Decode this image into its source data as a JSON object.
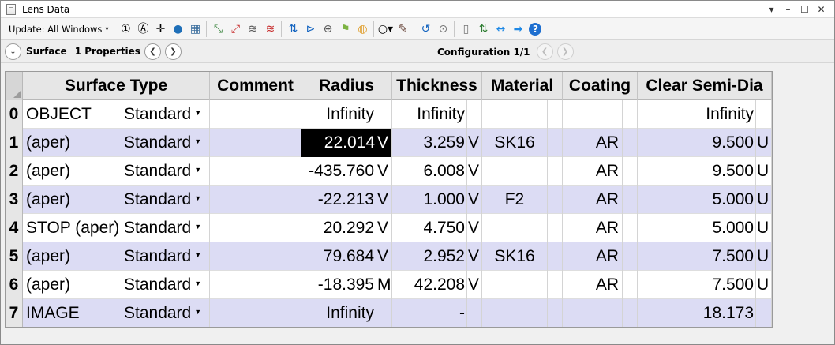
{
  "window": {
    "title": "Lens Data",
    "controls": {
      "dropdown": "▾",
      "minimize": "–",
      "maximize": "☐",
      "close": "✕"
    }
  },
  "toolbar": {
    "update_label": "Update: All Windows",
    "update_caret": "▾",
    "icons": [
      {
        "name": "ray-trace-1-icon",
        "glyph": "①",
        "color": "#000000"
      },
      {
        "name": "ray-trace-all-icon",
        "glyph": "Ⓐ",
        "color": "#000000"
      },
      {
        "name": "add-crosshair-icon",
        "glyph": "✛",
        "color": "#000000"
      },
      {
        "name": "globe-icon",
        "glyph": "●",
        "color": "#1e6fb8"
      },
      {
        "name": "catalog-icon",
        "glyph": "▦",
        "color": "#3b6e9e"
      },
      {
        "name": "sep"
      },
      {
        "name": "insert-surface-icon",
        "glyph": "⤡",
        "color": "#2e7d32"
      },
      {
        "name": "delete-surface-icon",
        "glyph": "⤢",
        "color": "#c62828"
      },
      {
        "name": "layers-icon",
        "glyph": "≋",
        "color": "#555555"
      },
      {
        "name": "remove-layers-icon",
        "glyph": "≋",
        "color": "#c62828"
      },
      {
        "name": "sep"
      },
      {
        "name": "tilt-decenter-icon",
        "glyph": "⇅",
        "color": "#1565c0"
      },
      {
        "name": "fold-mirror-icon",
        "glyph": "⊳",
        "color": "#1565c0"
      },
      {
        "name": "element-icon",
        "glyph": "⊕",
        "color": "#555555"
      },
      {
        "name": "flag-icon",
        "glyph": "⚑",
        "color": "#7cb342"
      },
      {
        "name": "palette-icon",
        "glyph": "◍",
        "color": "#e0a030"
      },
      {
        "name": "sep"
      },
      {
        "name": "circle-options-icon",
        "glyph": "○▾",
        "color": "#000000"
      },
      {
        "name": "pen-icon",
        "glyph": "✎",
        "color": "#6d4c41"
      },
      {
        "name": "sep"
      },
      {
        "name": "undo-arrow-icon",
        "glyph": "↺",
        "color": "#1565c0"
      },
      {
        "name": "toggle-icon",
        "glyph": "⊙",
        "color": "#777777"
      },
      {
        "name": "sep"
      },
      {
        "name": "page-icon",
        "glyph": "▯",
        "color": "#777777"
      },
      {
        "name": "swap-icon",
        "glyph": "⇅",
        "color": "#2e7d32"
      },
      {
        "name": "arrows-inward-icon",
        "glyph": "↔",
        "color": "#1e88e5"
      },
      {
        "name": "arrow-right-icon",
        "glyph": "➡",
        "color": "#1e88e5"
      },
      {
        "name": "help-icon",
        "glyph": "?",
        "color": "#ffffff"
      }
    ]
  },
  "navbar": {
    "surface_label": "Surface",
    "properties_label": "1 Properties",
    "configuration_label": "Configuration 1/1"
  },
  "table": {
    "headers": {
      "surface_type": "Surface Type",
      "comment": "Comment",
      "radius": "Radius",
      "thickness": "Thickness",
      "material": "Material",
      "coating": "Coating",
      "clear_semi_dia": "Clear Semi-Dia"
    },
    "rows": [
      {
        "num": "0",
        "name": "OBJECT",
        "type": "Standard",
        "comment": "",
        "radius": "Infinity",
        "radius_solve": "",
        "thickness": "Infinity",
        "thickness_solve": "",
        "material": "",
        "coating": "",
        "semi_dia": "Infinity",
        "semi_dia_solve": ""
      },
      {
        "num": "1",
        "name": "(aper)",
        "type": "Standard",
        "comment": "",
        "radius": "22.014",
        "radius_solve": "V",
        "thickness": "3.259",
        "thickness_solve": "V",
        "material": "SK16",
        "coating": "AR",
        "semi_dia": "9.500",
        "semi_dia_solve": "U"
      },
      {
        "num": "2",
        "name": "(aper)",
        "type": "Standard",
        "comment": "",
        "radius": "-435.760",
        "radius_solve": "V",
        "thickness": "6.008",
        "thickness_solve": "V",
        "material": "",
        "coating": "AR",
        "semi_dia": "9.500",
        "semi_dia_solve": "U"
      },
      {
        "num": "3",
        "name": "(aper)",
        "type": "Standard",
        "comment": "",
        "radius": "-22.213",
        "radius_solve": "V",
        "thickness": "1.000",
        "thickness_solve": "V",
        "material": "F2",
        "coating": "AR",
        "semi_dia": "5.000",
        "semi_dia_solve": "U"
      },
      {
        "num": "4",
        "name": "STOP (aper)",
        "type": "Standard",
        "comment": "",
        "radius": "20.292",
        "radius_solve": "V",
        "thickness": "4.750",
        "thickness_solve": "V",
        "material": "",
        "coating": "AR",
        "semi_dia": "5.000",
        "semi_dia_solve": "U"
      },
      {
        "num": "5",
        "name": "(aper)",
        "type": "Standard",
        "comment": "",
        "radius": "79.684",
        "radius_solve": "V",
        "thickness": "2.952",
        "thickness_solve": "V",
        "material": "SK16",
        "coating": "AR",
        "semi_dia": "7.500",
        "semi_dia_solve": "U"
      },
      {
        "num": "6",
        "name": "(aper)",
        "type": "Standard",
        "comment": "",
        "radius": "-18.395",
        "radius_solve": "M",
        "thickness": "42.208",
        "thickness_solve": "V",
        "material": "",
        "coating": "AR",
        "semi_dia": "7.500",
        "semi_dia_solve": "U"
      },
      {
        "num": "7",
        "name": "IMAGE",
        "type": "Standard",
        "comment": "",
        "radius": "Infinity",
        "radius_solve": "",
        "thickness": "-",
        "thickness_solve": "",
        "material": "",
        "coating": "",
        "semi_dia": "18.173",
        "semi_dia_solve": ""
      }
    ],
    "selected_cell": {
      "row": 1,
      "column": "radius"
    }
  },
  "colors": {
    "alt_row": "#dcdcf4",
    "header_bg": "#e6e6e6",
    "selection_bg": "#000000"
  }
}
